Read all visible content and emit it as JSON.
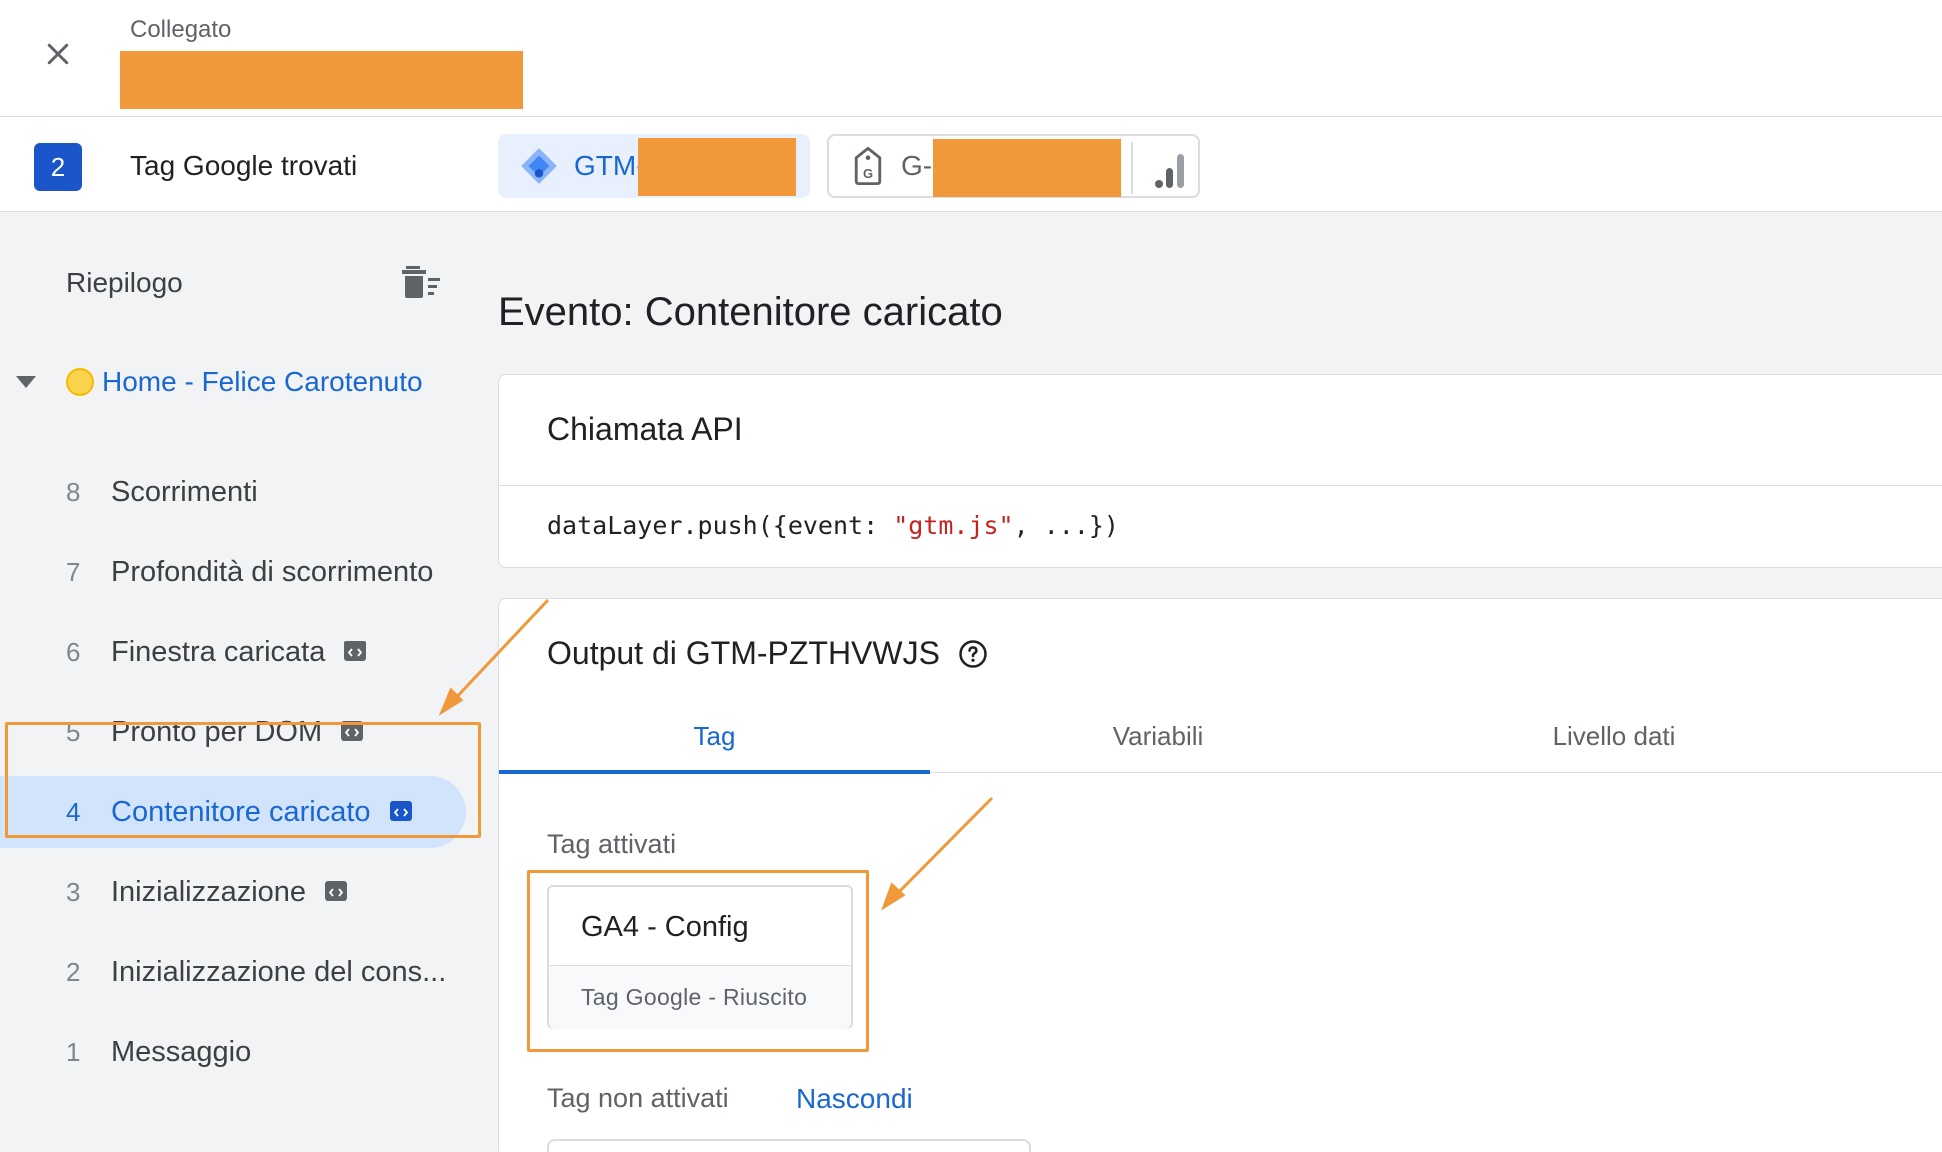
{
  "topbar": {
    "connected_label": "Collegato"
  },
  "tags_bar": {
    "count": "2",
    "label": "Tag Google trovati",
    "gtm_chip_prefix": "GTM-",
    "ga_chip_prefix": "G-"
  },
  "sidebar": {
    "summary_label": "Riepilogo",
    "page_title": "Home - Felice Carotenuto",
    "events": [
      {
        "num": "8",
        "name": "Scorrimenti"
      },
      {
        "num": "7",
        "name": "Profondità di scorrimento"
      },
      {
        "num": "6",
        "name": "Finestra caricata"
      },
      {
        "num": "5",
        "name": "Pronto per DOM"
      },
      {
        "num": "4",
        "name": "Contenitore caricato"
      },
      {
        "num": "3",
        "name": "Inizializzazione"
      },
      {
        "num": "2",
        "name": "Inizializzazione del cons..."
      },
      {
        "num": "1",
        "name": "Messaggio"
      }
    ]
  },
  "main": {
    "event_title": "Evento: Contenitore caricato",
    "api_card": {
      "heading": "Chiamata API",
      "code_prefix": "dataLayer.push({event: ",
      "code_string": "\"gtm.js\"",
      "code_suffix": ", ...})"
    },
    "output_card": {
      "heading": "Output di GTM-PZTHVWJS",
      "tabs": [
        "Tag",
        "Variabili",
        "Livello dati"
      ],
      "fired_label": "Tag attivati",
      "fired_tag": {
        "name": "GA4 - Config",
        "status": "Tag Google - Riuscito"
      },
      "not_fired_label": "Tag non attivati",
      "hide_link": "Nascondi"
    }
  },
  "colors": {
    "accent_blue": "#1967d2",
    "selected_bg": "#d2e3fc",
    "annotation_orange": "#f0983a",
    "redaction_orange": "#f0983a"
  }
}
